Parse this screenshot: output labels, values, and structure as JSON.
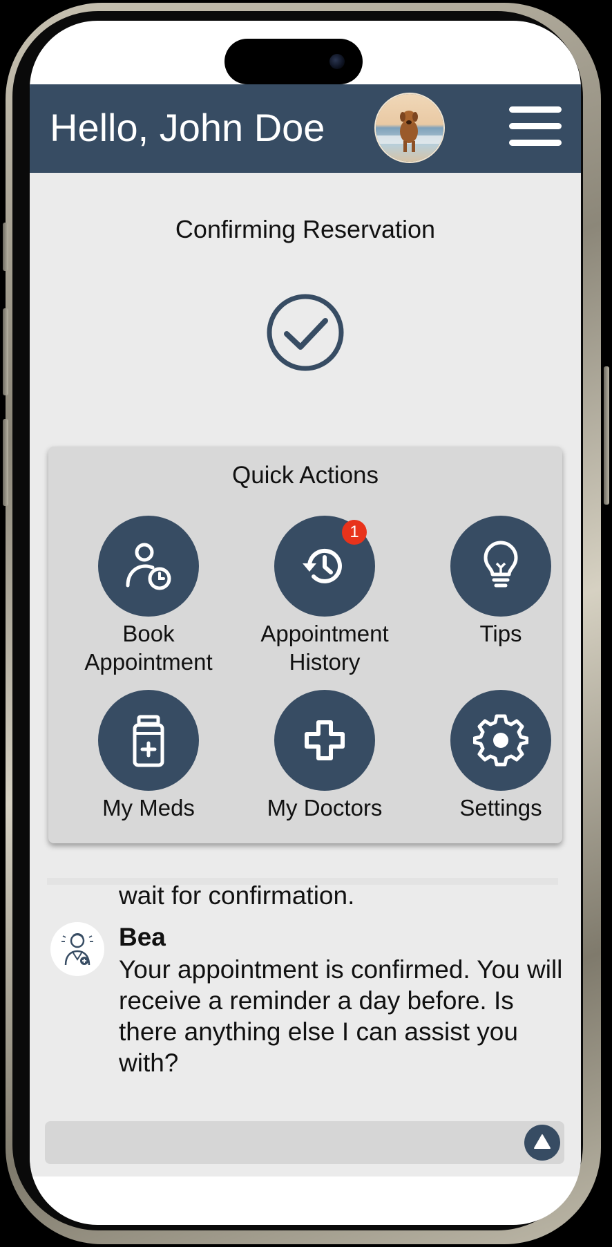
{
  "header": {
    "greeting": "Hello, John Doe",
    "avatar_icon": "dog-photo-avatar",
    "menu_icon": "hamburger-menu-icon",
    "background_color": "#374c63"
  },
  "page": {
    "title": "Confirming Reservation",
    "status_icon": "check-circle-icon"
  },
  "quick_actions": {
    "title": "Quick Actions",
    "items": [
      {
        "label_line1": "Book",
        "label_line2": "Appointment",
        "icon": "person-clock-icon"
      },
      {
        "label_line1": "Appointment",
        "label_line2": "History",
        "icon": "history-icon",
        "badge": "1"
      },
      {
        "label_line1": "Tips",
        "label_line2": "",
        "icon": "lightbulb-icon"
      },
      {
        "label_line1": "My Meds",
        "label_line2": "",
        "icon": "medicine-bottle-icon"
      },
      {
        "label_line1": "My Doctors",
        "label_line2": "",
        "icon": "medical-cross-icon"
      },
      {
        "label_line1": "Settings",
        "label_line2": "",
        "icon": "gear-icon"
      }
    ]
  },
  "chat": {
    "previous_fragment": "wait for confirmation.",
    "bot_name": "Bea",
    "bot_avatar_icon": "doctor-avatar-icon",
    "bot_message": "Your appointment is confirmed. You will receive a reminder a day before. Is there anything else I can assist you with?",
    "input_value": "",
    "send_icon": "send-arrow-icon"
  },
  "colors": {
    "accent": "#374c63",
    "badge": "#e8331b",
    "app_background": "#ebebeb",
    "card_background": "#d8d8d8"
  }
}
